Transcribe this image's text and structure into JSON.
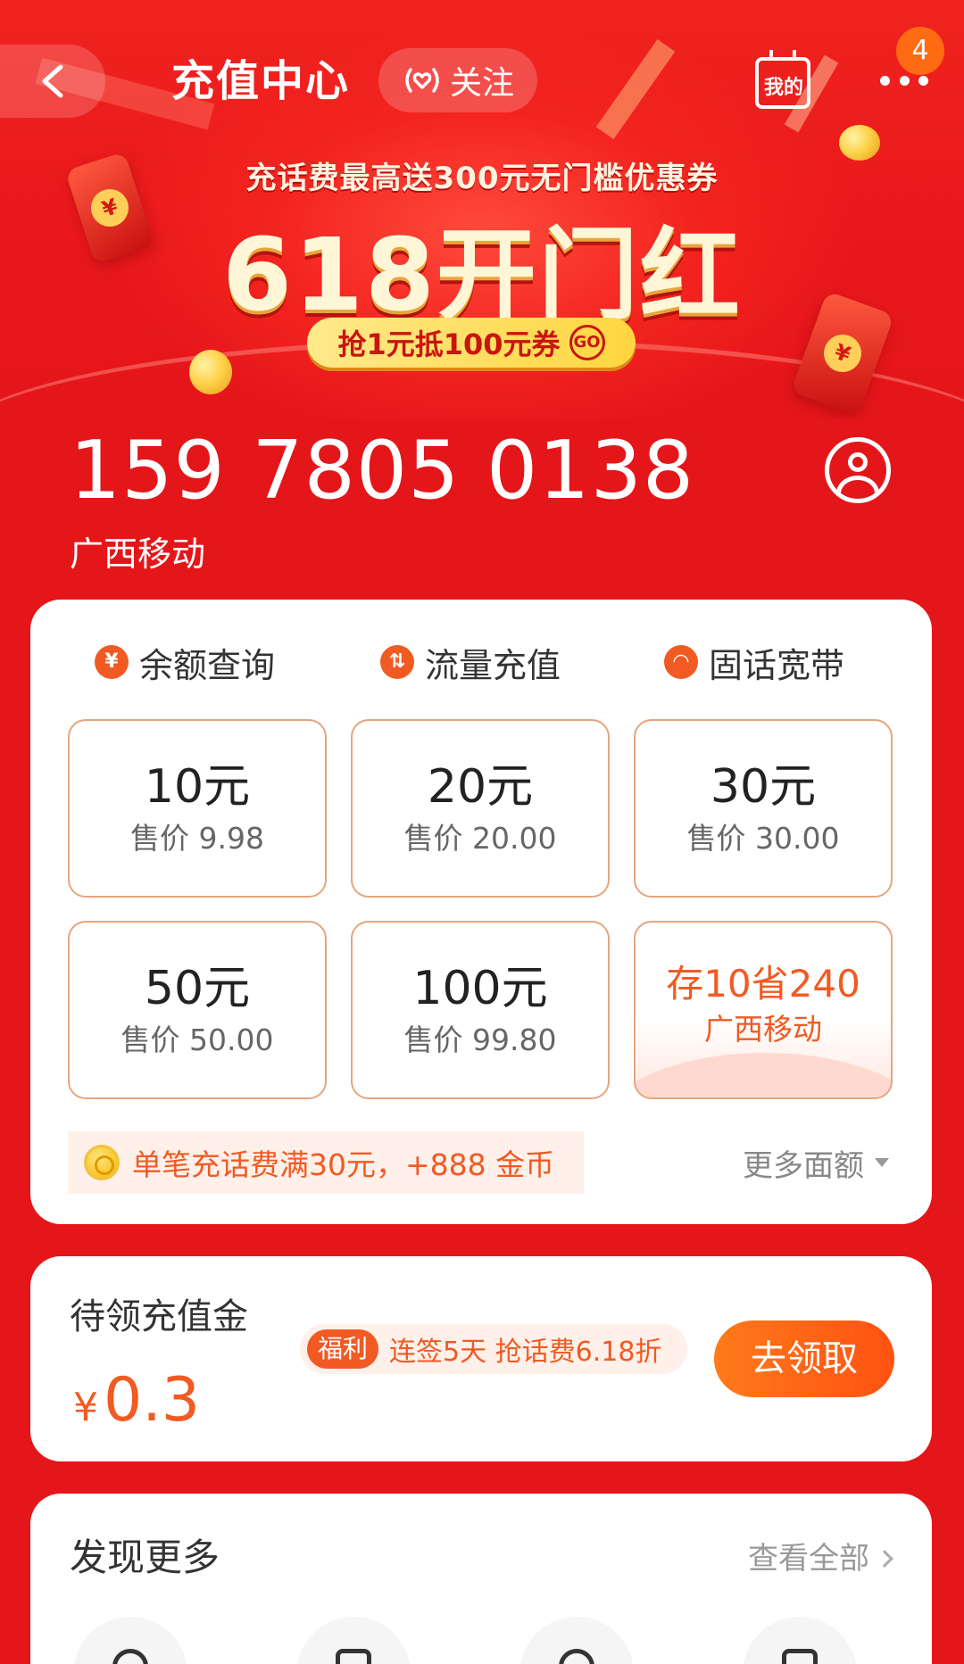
{
  "header": {
    "title": "充值中心",
    "follow_label": "关注",
    "mine_label": "我的",
    "notification_count": "4"
  },
  "banner": {
    "subtitle": "充话费最高送300元无门槛优惠券",
    "headline": "618开门红",
    "pill_text": "抢1元抵100元券",
    "pill_go": "GO"
  },
  "account": {
    "phone_number": "159 7805 0138",
    "carrier": "广西移动"
  },
  "quick_links": [
    {
      "icon": "yen-icon",
      "glyph": "¥",
      "label": "余额查询"
    },
    {
      "icon": "data-transfer-icon",
      "glyph": "⇅",
      "label": "流量充值"
    },
    {
      "icon": "wifi-icon",
      "glyph": "◠",
      "label": "固话宽带"
    }
  ],
  "recharge_options": [
    {
      "face": "10元",
      "price": "售价 9.98"
    },
    {
      "face": "20元",
      "price": "售价 20.00"
    },
    {
      "face": "30元",
      "price": "售价 30.00"
    },
    {
      "face": "50元",
      "price": "售价 50.00"
    },
    {
      "face": "100元",
      "price": "售价 99.80"
    }
  ],
  "promo_tile": {
    "title": "存10省240",
    "subtitle": "广西移动"
  },
  "coin_note": "单笔充话费满30元，+888 金币",
  "more_amounts": "更多面额",
  "pending": {
    "title": "待领充值金",
    "currency": "¥",
    "amount": "0.3",
    "welfare_tag": "福利",
    "welfare_text": "连签5天 抢话费6.18折",
    "claim_button": "去领取"
  },
  "discover": {
    "title": "发现更多",
    "view_all": "查看全部"
  },
  "colors": {
    "background_red": "#e4161a",
    "accent_orange": "#f15a22",
    "tile_border": "#e6a57e",
    "badge_orange": "#ff6b12"
  }
}
